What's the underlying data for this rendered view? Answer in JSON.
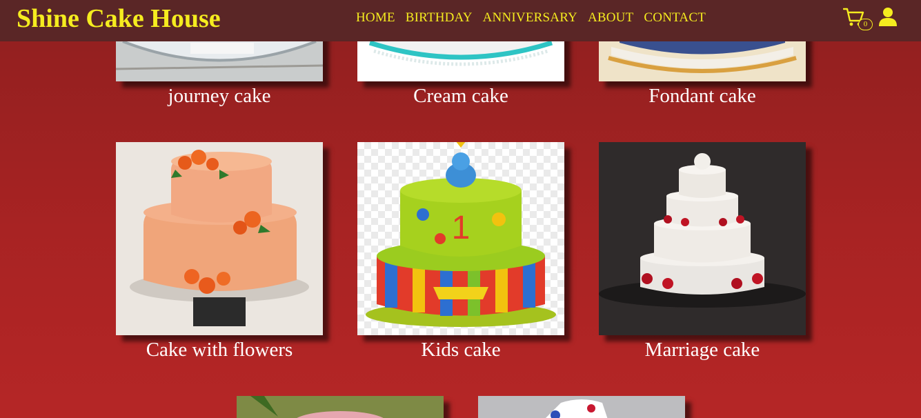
{
  "header": {
    "brand": "Shine Cake House",
    "nav": [
      "HOME",
      "BIRTHDAY",
      "ANNIVERSARY",
      "ABOUT",
      "CONTACT"
    ],
    "cart_count": "0",
    "cart_icon": "shopping-cart-icon",
    "user_icon": "user-icon",
    "accent_color": "#f5ec1f",
    "bar_color": "#5a2626"
  },
  "products": [
    {
      "name": "journey cake",
      "image": "journey-cake-photo"
    },
    {
      "name": "Cream cake",
      "image": "cream-cake-photo"
    },
    {
      "name": "Fondant cake",
      "image": "fondant-cake-photo"
    },
    {
      "name": "Cake with flowers",
      "image": "flower-cake-photo"
    },
    {
      "name": "Kids cake",
      "image": "kids-cake-photo"
    },
    {
      "name": "Marriage cake",
      "image": "marriage-cake-photo"
    },
    {
      "name": "",
      "image": "cake-photo"
    },
    {
      "name": "",
      "image": "cake-photo"
    }
  ],
  "background_color": "#a82323"
}
